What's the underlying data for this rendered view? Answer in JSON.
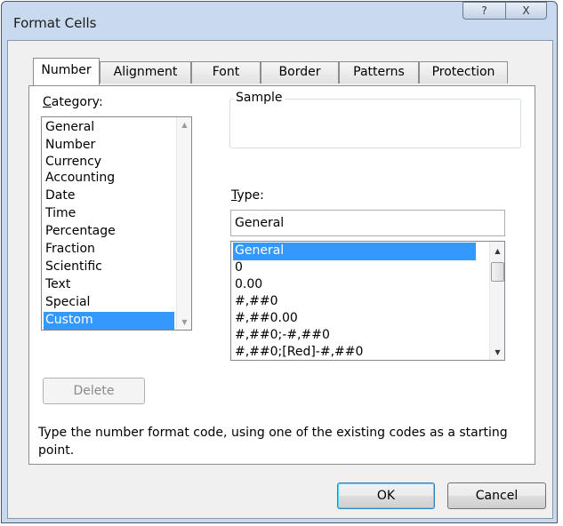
{
  "window": {
    "title": "Format Cells",
    "help_glyph": "?",
    "close_glyph": "X"
  },
  "tabs": [
    {
      "label": "Number",
      "active": true
    },
    {
      "label": "Alignment",
      "active": false
    },
    {
      "label": "Font",
      "active": false
    },
    {
      "label": "Border",
      "active": false
    },
    {
      "label": "Patterns",
      "active": false
    },
    {
      "label": "Protection",
      "active": false
    }
  ],
  "category": {
    "label_accel": "C",
    "label_rest": "ategory:",
    "items": [
      "General",
      "Number",
      "Currency",
      "Accounting",
      "Date",
      "Time",
      "Percentage",
      "Fraction",
      "Scientific",
      "Text",
      "Special",
      "Custom"
    ],
    "selected": "Custom"
  },
  "sample": {
    "label": "Sample",
    "value": ""
  },
  "type": {
    "label_accel": "T",
    "label_rest": "ype:",
    "value": "General",
    "items": [
      "General",
      "0",
      "0.00",
      "#,##0",
      "#,##0.00",
      "#,##0;-#,##0",
      "#,##0;[Red]-#,##0"
    ],
    "selected": "General"
  },
  "delete_button": {
    "label": "Delete",
    "enabled": false
  },
  "description": "Type the number format code, using one of the existing codes as a starting point.",
  "footer": {
    "ok_label": "OK",
    "cancel_label": "Cancel"
  },
  "icons": {
    "scroll_up": "scroll-up-arrow-icon",
    "scroll_down": "scroll-down-arrow-icon"
  },
  "colors": {
    "selection": "#3399ff",
    "window_frame": "#c9daee"
  }
}
